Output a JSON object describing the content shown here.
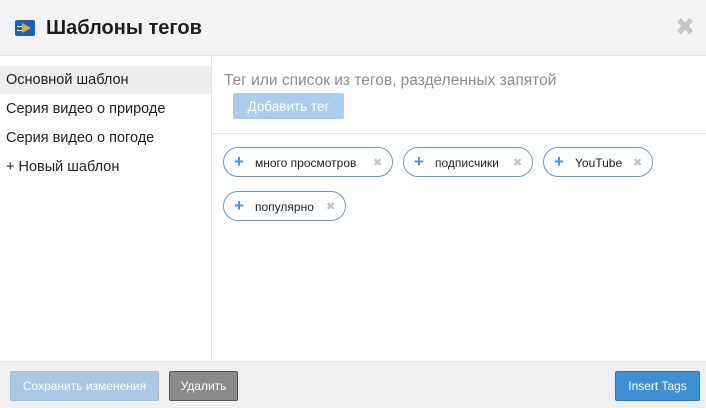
{
  "header": {
    "title": "Шаблоны тегов",
    "logo_icon": "video-logo-icon",
    "close_glyph": "✖"
  },
  "sidebar": {
    "items": [
      {
        "label": "Основной шаблон",
        "active": true
      },
      {
        "label": "Серия видео о природе",
        "active": false
      },
      {
        "label": "Серия видео о погоде",
        "active": false
      },
      {
        "label": "+ Новый шаблон",
        "active": false
      }
    ]
  },
  "main": {
    "input_value": "",
    "input_placeholder": "Тег или список из тегов, разделенных запятой",
    "add_button_label": "Добавить тег",
    "tags": [
      {
        "label": "много просмотров"
      },
      {
        "label": "подписчики"
      },
      {
        "label": "YouTube"
      },
      {
        "label": "популярно"
      }
    ],
    "tag_plus_glyph": "+",
    "tag_remove_glyph": "✖"
  },
  "footer": {
    "save_label": "Сохранить изменения",
    "delete_label": "Удалить",
    "insert_label": "Insert Tags"
  },
  "colors": {
    "accent": "#3d8fd6",
    "accent_light": "#a9cdec",
    "chip_border": "#5b9bd5",
    "header_bg": "#f3f3f3"
  }
}
